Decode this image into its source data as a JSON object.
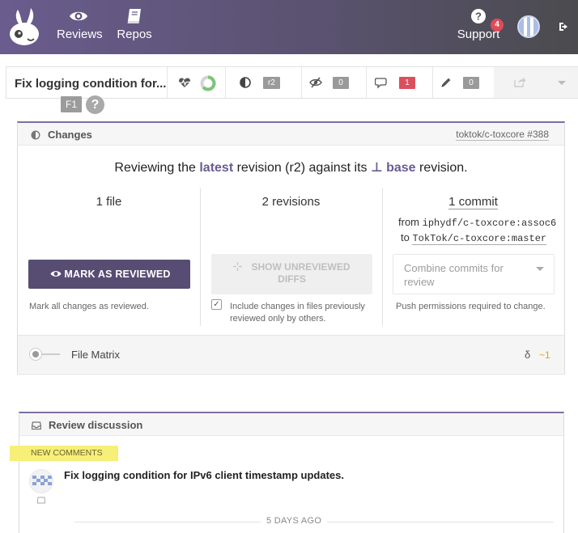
{
  "nav": {
    "reviews_label": "Reviews",
    "repos_label": "Repos",
    "support_label": "Support",
    "support_badge": "4",
    "icons": {
      "logo": "rabbit-logo-icon",
      "reviews": "eye-icon",
      "repos": "book-icon",
      "support": "question-circle-icon",
      "signout": "sign-out-icon"
    }
  },
  "review_header": {
    "title": "Fix logging condition for...",
    "revision_count": "r2",
    "unreviewed_count": "0",
    "discussion_count": "1",
    "drafts_count": "0",
    "f1_badge": "F1",
    "help_symbol": "?",
    "icons": [
      "heartbeat-icon",
      "progress-donut-icon",
      "half-circle-icon",
      "eye-slash-icon",
      "comments-icon",
      "pencil-icon",
      "share-icon",
      "chevron-down-icon"
    ]
  },
  "changes": {
    "title": "Changes",
    "repo_ref": "toktok/c-toxcore #388",
    "reviewing": {
      "prefix": "Reviewing the ",
      "latest": "latest",
      "middle": " revision (r2) against its ",
      "base_symbol": "⊥",
      "base": "base",
      "suffix": " revision."
    },
    "files": {
      "count_text": "1 file",
      "button_label": "MARK AS REVIEWED",
      "note": "Mark all changes as reviewed."
    },
    "revisions": {
      "count_text": "2 revisions",
      "button_line1": "SHOW UNREVIEWED",
      "button_line2": "DIFFS",
      "checkbox_checked": true,
      "note_line1": "Include changes in files previously",
      "note_line2": "reviewed only by others."
    },
    "commits": {
      "count_text": "1 commit",
      "from_label": "from",
      "from_ref": "iphydf/c-toxcore:assoc6",
      "to_label": "to",
      "to_ref": "TokTok/c-toxcore:master",
      "combine_placeholder": "Combine commits for review",
      "note": "Push permissions required to change."
    },
    "file_matrix": {
      "label": "File Matrix",
      "delta_symbol": "δ",
      "delta_value": "~1"
    }
  },
  "discussion": {
    "title": "Review discussion",
    "new_comments_label": "NEW COMMENTS",
    "comment_text": "Fix logging condition for IPv6 client timestamp updates.",
    "time_ago": "5 DAYS AGO"
  },
  "colors": {
    "accent": "#6a5b96",
    "primary_button": "#574d73",
    "badge_red": "#db4f5d",
    "highlight_yellow": "#f6ef78"
  }
}
